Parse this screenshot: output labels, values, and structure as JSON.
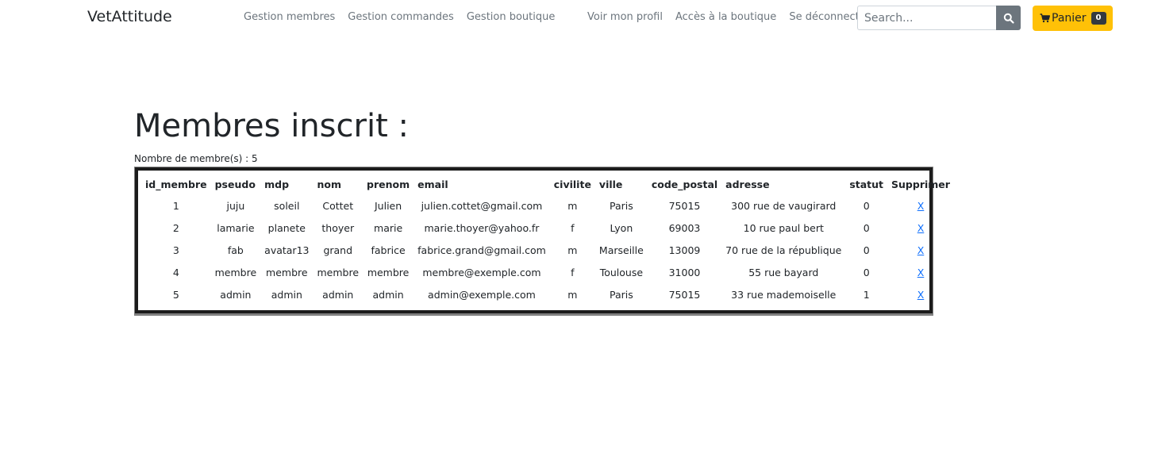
{
  "nav": {
    "brand": "VetAttitude",
    "left_links": [
      "Gestion membres",
      "Gestion commandes",
      "Gestion boutique"
    ],
    "right_links": [
      "Voir mon profil",
      "Accès à la boutique",
      "Se déconnecter"
    ],
    "search_placeholder": "Search...",
    "cart_label": "Panier",
    "cart_count": "0"
  },
  "colors": {
    "cart": "#ffc107",
    "search_button": "#6c757d",
    "link": "#0d6efd",
    "table_border": "#1c1c1c"
  },
  "icons": [
    "search-icon",
    "cart-icon"
  ],
  "main": {
    "title": "Membres inscrit :",
    "count_text": "Nombre de membre(s) : 5"
  },
  "table": {
    "headers": [
      "id_membre",
      "pseudo",
      "mdp",
      "nom",
      "prenom",
      "email",
      "civilite",
      "ville",
      "code_postal",
      "adresse",
      "statut",
      "Supprimer"
    ],
    "rows": [
      [
        "1",
        "juju",
        "soleil",
        "Cottet",
        "Julien",
        "julien.cottet@gmail.com",
        "m",
        "Paris",
        "75015",
        "300 rue de vaugirard",
        "0",
        "X"
      ],
      [
        "2",
        "lamarie",
        "planete",
        "thoyer",
        "marie",
        "marie.thoyer@yahoo.fr",
        "f",
        "Lyon",
        "69003",
        "10 rue paul bert",
        "0",
        "X"
      ],
      [
        "3",
        "fab",
        "avatar13",
        "grand",
        "fabrice",
        "fabrice.grand@gmail.com",
        "m",
        "Marseille",
        "13009",
        "70 rue de la république",
        "0",
        "X"
      ],
      [
        "4",
        "membre",
        "membre",
        "membre",
        "membre",
        "membre@exemple.com",
        "f",
        "Toulouse",
        "31000",
        "55 rue bayard",
        "0",
        "X"
      ],
      [
        "5",
        "admin",
        "admin",
        "admin",
        "admin",
        "admin@exemple.com",
        "m",
        "Paris",
        "75015",
        "33 rue mademoiselle",
        "1",
        "X"
      ]
    ]
  }
}
